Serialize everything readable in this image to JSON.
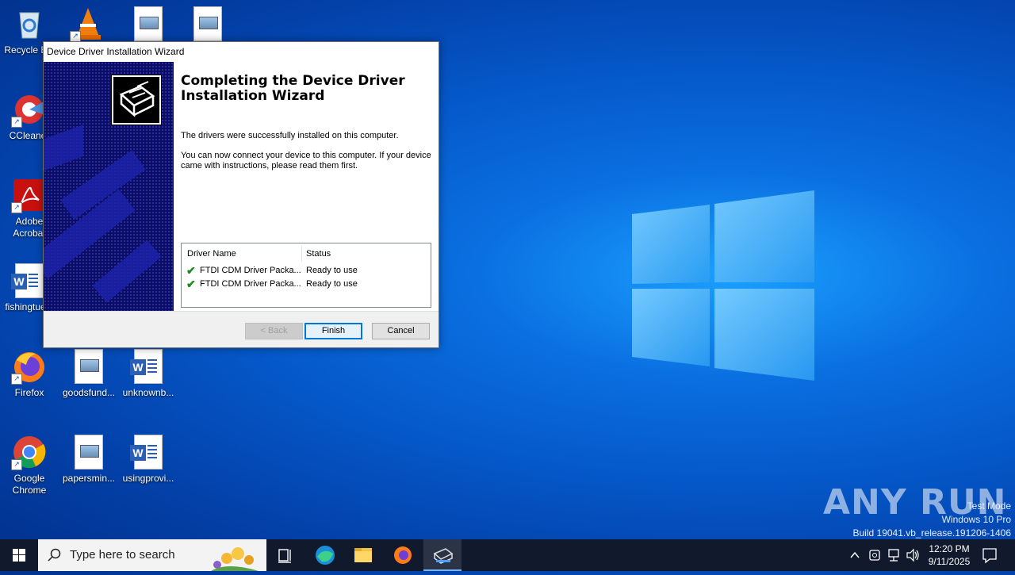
{
  "desktop": {
    "icons": [
      {
        "label": "Recycle Bin",
        "icon": "recycle-bin-icon"
      },
      {
        "label": "",
        "icon": "vlc-icon"
      },
      {
        "label": "",
        "icon": "image-file-icon"
      },
      {
        "label": "",
        "icon": "image-file-icon"
      },
      {
        "label": "CCleaner",
        "icon": "ccleaner-icon"
      },
      {
        "label": "Adobe Acrobat",
        "icon": "acrobat-icon"
      },
      {
        "label": "fishingtue...",
        "icon": "word-doc-icon"
      },
      {
        "label": "Firefox",
        "icon": "firefox-icon"
      },
      {
        "label": "goodsfund...",
        "icon": "image-file-icon"
      },
      {
        "label": "unknownb...",
        "icon": "word-doc-icon"
      },
      {
        "label": "Google Chrome",
        "icon": "chrome-icon"
      },
      {
        "label": "papersmin...",
        "icon": "image-file-icon"
      },
      {
        "label": "usingprovi...",
        "icon": "word-doc-icon"
      }
    ]
  },
  "dialog": {
    "title": "Device Driver Installation Wizard",
    "heading": "Completing the Device Driver Installation Wizard",
    "message1": "The drivers were successfully installed on this computer.",
    "message2": "You can now connect your device to this computer. If your device came with instructions, please read them first.",
    "table": {
      "headers": [
        "Driver Name",
        "Status"
      ],
      "rows": [
        {
          "name": "FTDI CDM Driver Packa...",
          "status": "Ready to use"
        },
        {
          "name": "FTDI CDM Driver Packa...",
          "status": "Ready to use"
        }
      ]
    },
    "buttons": {
      "back": "< Back",
      "finish": "Finish",
      "cancel": "Cancel"
    }
  },
  "taskbar": {
    "search_placeholder": "Type here to search",
    "time": "12:20 PM",
    "date": "9/11/2025"
  },
  "watermark": {
    "line1": "Test Mode",
    "line2": "Windows 10 Pro",
    "line3": "Build 19041.vb_release.191206-1406",
    "brand": "ANY RUN"
  },
  "colors": {
    "accent": "#0078d7",
    "check": "#1a8a1a",
    "taskbar": "#101a2c"
  }
}
